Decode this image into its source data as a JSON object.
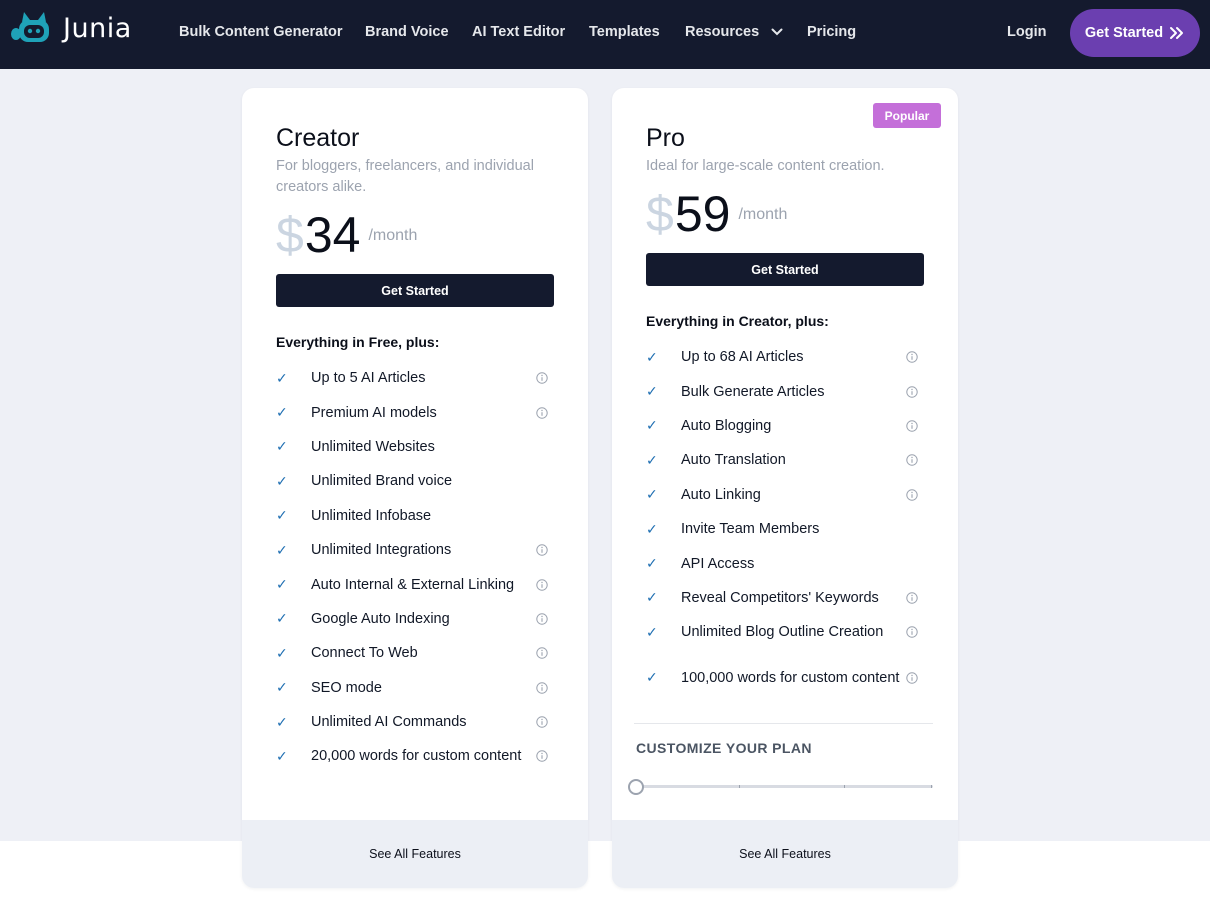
{
  "brand": {
    "name": "Junia"
  },
  "nav": {
    "links": [
      "Bulk Content Generator",
      "Brand Voice",
      "AI Text Editor",
      "Templates",
      "Resources",
      "Pricing"
    ],
    "login": "Login",
    "cta": "Get Started"
  },
  "creator": {
    "name": "Creator",
    "description": "For bloggers, freelancers, and individual creators alike.",
    "currency": "$",
    "price": "34",
    "period": "/month",
    "button": "Get Started",
    "features_heading": "Everything in Free, plus:",
    "features": [
      {
        "label": "Up to 5 AI Articles",
        "info": true
      },
      {
        "label": "Premium AI models",
        "info": true
      },
      {
        "label": "Unlimited Websites",
        "info": false
      },
      {
        "label": "Unlimited Brand voice",
        "info": false
      },
      {
        "label": "Unlimited Infobase",
        "info": false
      },
      {
        "label": "Unlimited Integrations",
        "info": true
      },
      {
        "label": "Auto Internal & External Linking",
        "info": true
      },
      {
        "label": "Google Auto Indexing",
        "info": true
      },
      {
        "label": "Connect To Web",
        "info": true
      },
      {
        "label": "SEO mode",
        "info": true
      },
      {
        "label": "Unlimited AI Commands",
        "info": true
      },
      {
        "label": "20,000 words for custom content",
        "info": true
      }
    ],
    "footer": "See All Features"
  },
  "pro": {
    "badge": "Popular",
    "name": "Pro",
    "description": "Ideal for large-scale content creation.",
    "currency": "$",
    "price": "59",
    "period": "/month",
    "button": "Get Started",
    "features_heading": "Everything in Creator, plus:",
    "features": [
      {
        "label": "Up to 68 AI Articles",
        "info": true
      },
      {
        "label": "Bulk Generate Articles",
        "info": true
      },
      {
        "label": "Auto Blogging",
        "info": true
      },
      {
        "label": "Auto Translation",
        "info": true
      },
      {
        "label": "Auto Linking",
        "info": true
      },
      {
        "label": "Invite Team Members",
        "info": false
      },
      {
        "label": "API Access",
        "info": false
      },
      {
        "label": "Reveal Competitors' Keywords",
        "info": true
      },
      {
        "label": "Unlimited Blog Outline Creation",
        "info": true
      },
      {
        "label": "100,000 words for custom content",
        "info": true
      }
    ],
    "customize_title": "CUSTOMIZE YOUR PLAN",
    "slider_value_fraction": 0,
    "footer": "See All Features"
  },
  "colors": {
    "nav_bg": "#141a2e",
    "cta_bg": "#6b3fb0",
    "badge_bg": "#c46fd9",
    "check": "#1f6fb2",
    "page_bg": "#eef0f6"
  },
  "icons": [
    "junia-logo-icon",
    "chevron-down-icon",
    "double-chevron-right-icon",
    "check-icon",
    "info-icon"
  ]
}
